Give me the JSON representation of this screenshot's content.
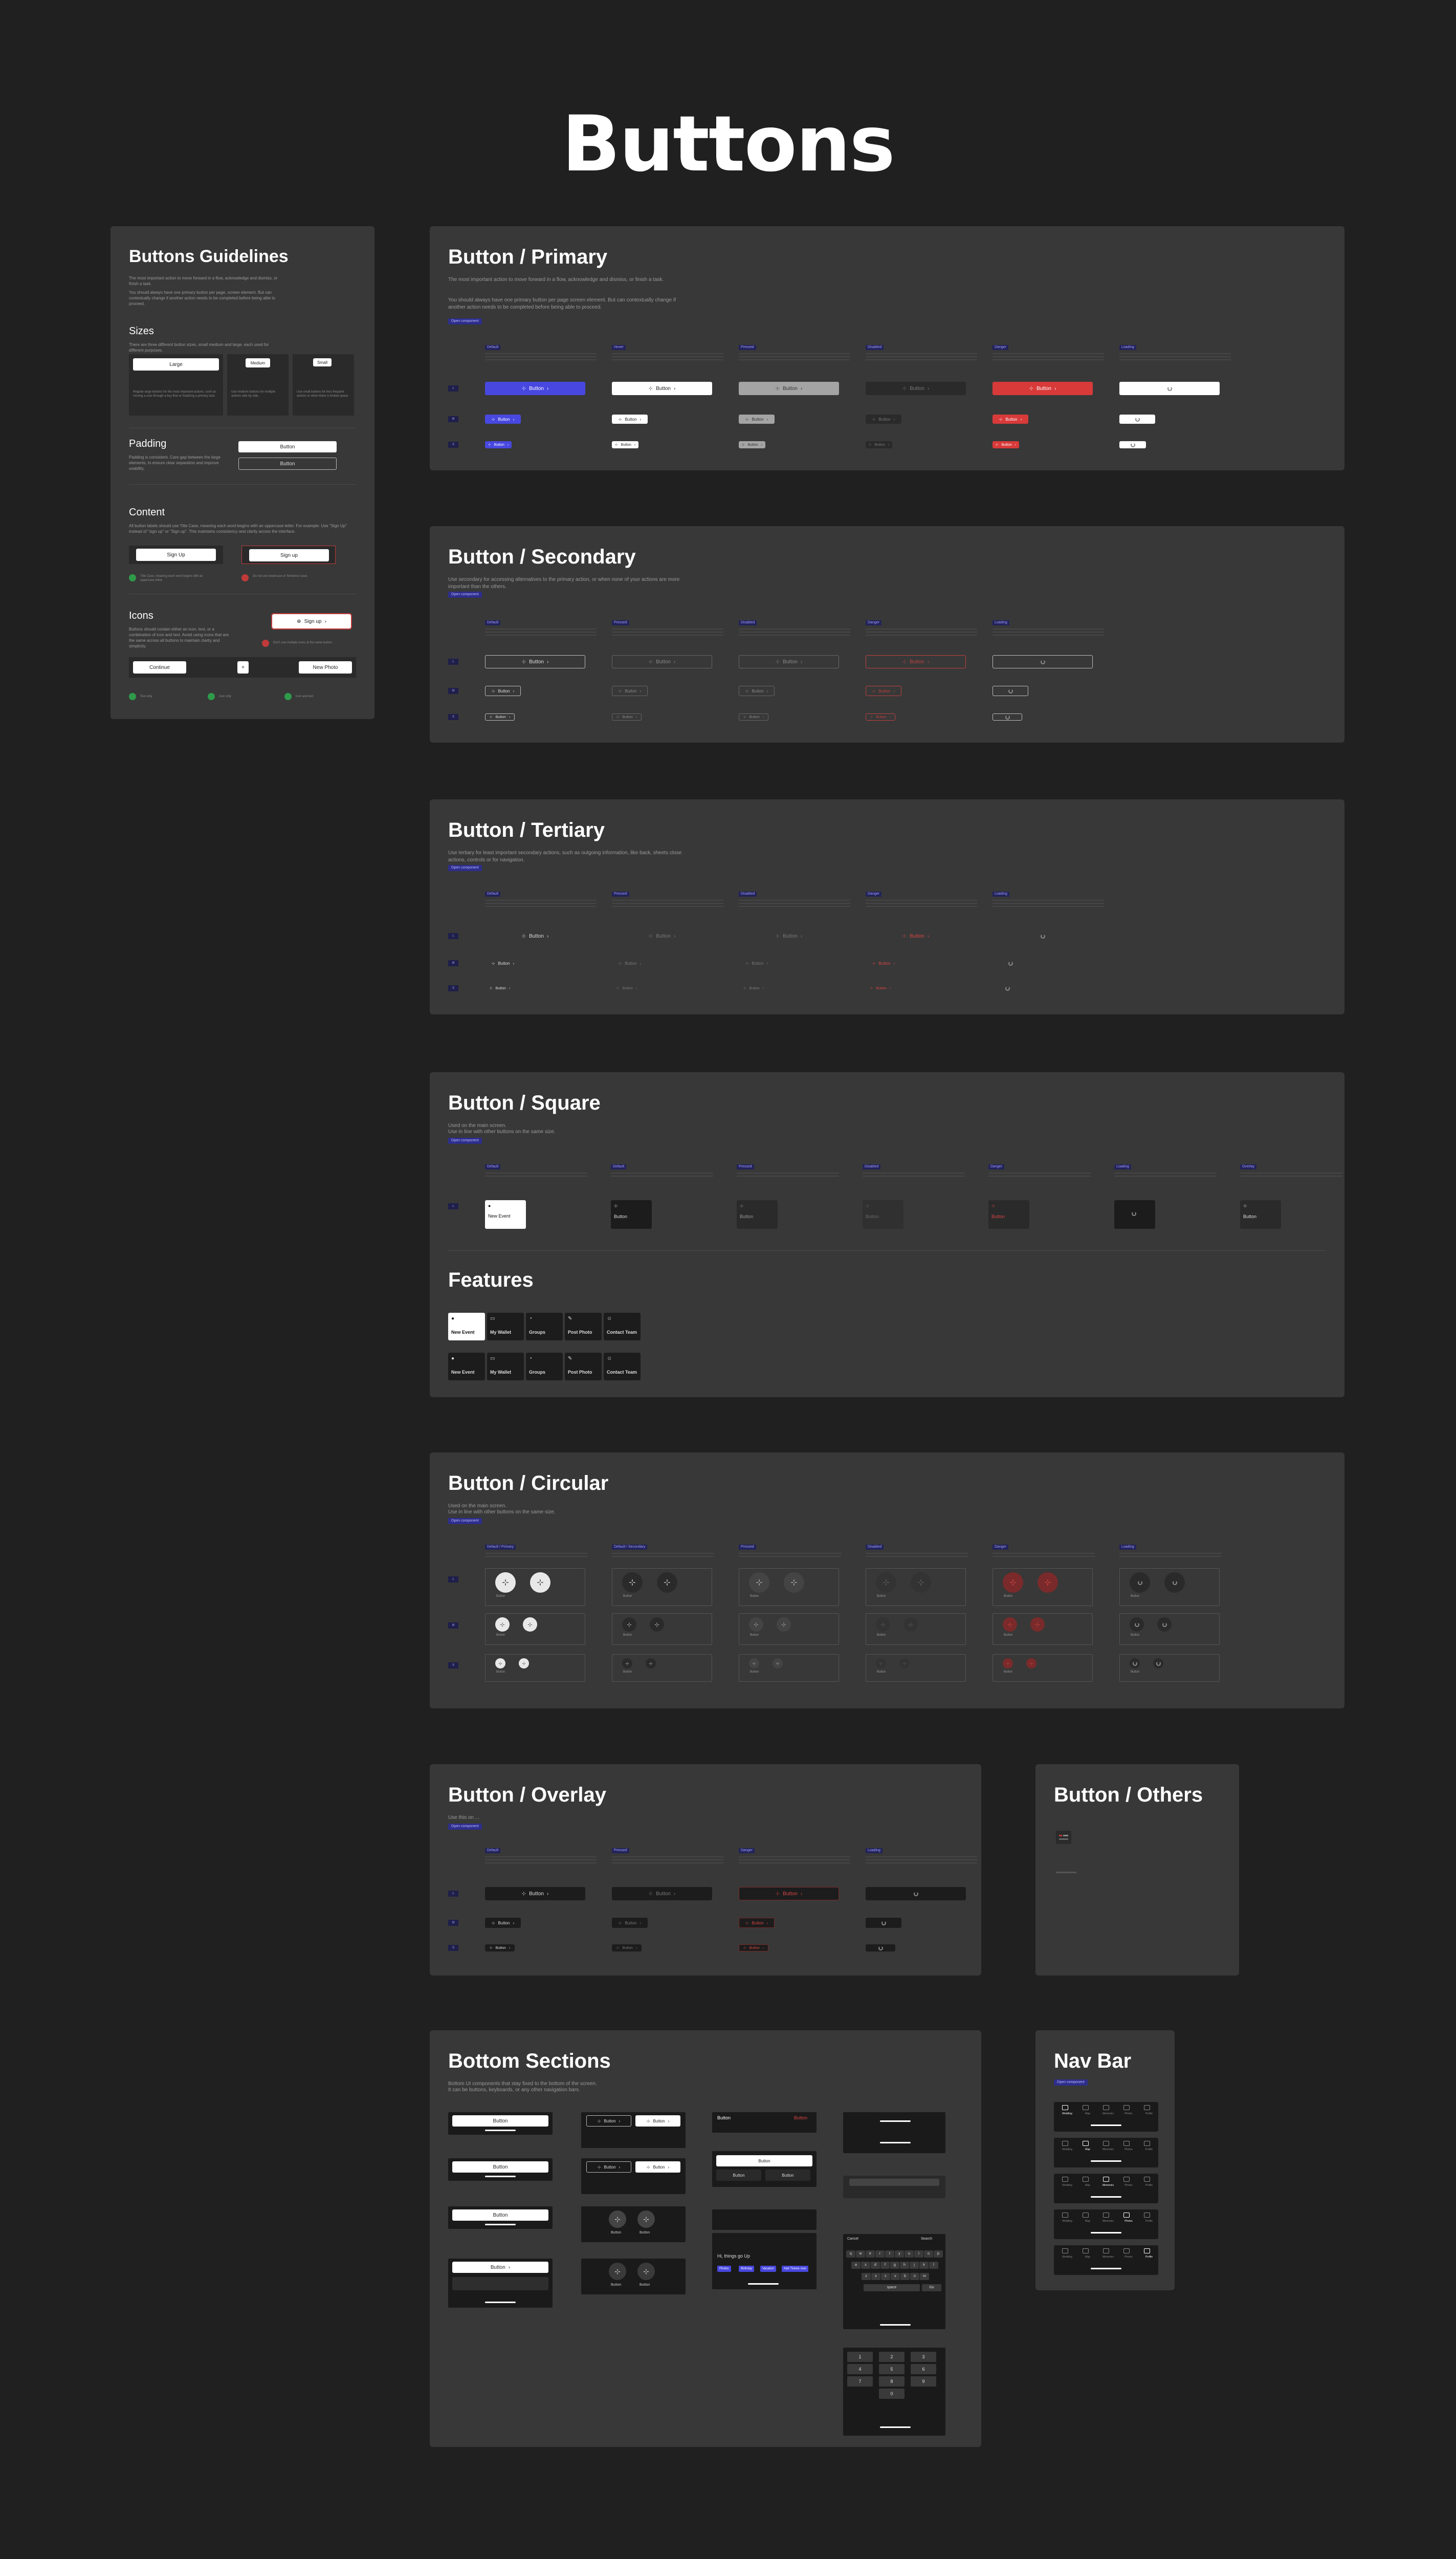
{
  "page_title": "Buttons",
  "guidelines": {
    "title": "Buttons Guidelines",
    "intro": "The most important action to move forward in a flow, acknowledge and dismiss, or finish a task.",
    "intro2": "You should always have one primary button per page, screen element. But can contextually change if another action needs to be completed before being able to proceed.",
    "sizes_h": "Sizes",
    "sizes_p": "There are three different button sizes, small medium and large, each used for different purposes.",
    "size_large": "Large",
    "size_medium": "Medium",
    "size_small": "Small",
    "size_large_p": "Regular large buttons for the most important actions, such as moving a user through a key flow or finalizing a primary task.",
    "size_medium_p": "Use medium buttons for multiple actions side by side.",
    "size_small_p": "Use small buttons for less frequent actions or when there is limited space.",
    "padding_h": "Padding",
    "padding_p": "Padding is consistent. Care gap between the large elements, to ensure clear separation and improve usability.",
    "padding_btn1": "Button",
    "padding_btn2": "Button",
    "content_h": "Content",
    "content_p": "All button labels should use Title Case, meaning each word begins with an uppercase letter. For example: Use \"Sign Up\" instead of \"sign up\" or \"Sign up\". This maintains consistency and clarity across the interface.",
    "signup1": "Sign Up",
    "signup2": "Sign up",
    "do_text": "Title Case, meaning each word begins with an uppercase letter.",
    "dont_text": "Do not use lowercase or Sentence case.",
    "icons_h": "Icons",
    "icons_p": "Buttons should contain either an icon, text, or a combination of icon and text. Avoid using icons that are the same across all buttons to maintain clarity and simplicity.",
    "icons_btn": "Sign up",
    "dont_icons": "Don't use multiple icons at the same button.",
    "continue": "Continue",
    "new_photo": "New Photo",
    "ok1": "Text only",
    "ok2": "Icon only",
    "ok3": "Icon and text"
  },
  "primary": {
    "title": "Button / Primary",
    "desc": "The most important action to move forward in a flow, acknowledge and dismiss, or finish a task.",
    "desc2": "You should always have one primary button per page screen element. But can contextually change if another action needs to be completed before being able to proceed.",
    "link": "Open component",
    "cols": [
      "Default",
      "Hover",
      "Pressed",
      "Disabled",
      "Danger",
      "Loading"
    ],
    "label": "Button"
  },
  "secondary": {
    "title": "Button / Secondary",
    "desc": "Use secondary for accessing alternatives to the primary action, or when none of your actions are more important than the others.",
    "link": "Open component",
    "cols": [
      "Default",
      "Pressed",
      "Disabled",
      "Danger",
      "Loading"
    ],
    "label": "Button"
  },
  "tertiary": {
    "title": "Button / Tertiary",
    "desc": "Use tertiary for least important secondary actions, such as outgoing information, like back, sheets close actions, controls or for navigation.",
    "link": "Open component",
    "cols": [
      "Default",
      "Pressed",
      "Disabled",
      "Danger",
      "Loading"
    ],
    "label": "Button"
  },
  "square": {
    "title": "Button / Square",
    "desc": "Used on the main screen.",
    "desc2": "Use in line with other buttons on the same size.",
    "link": "Open component",
    "cols": [
      "Default",
      "Default",
      "Pressed",
      "Disabled",
      "Danger",
      "Loading",
      "Overlay"
    ],
    "new_event": "New Event",
    "label": "Button"
  },
  "features": {
    "title": "Features",
    "items": [
      "New Event",
      "My Wallet",
      "Groups",
      "Post Photo",
      "Contact Team"
    ]
  },
  "circular": {
    "title": "Button / Circular",
    "desc": "Used on the main screen.",
    "desc2": "Use in line with other buttons on the same size.",
    "link": "Open component",
    "cols": [
      "Default / Primary",
      "Default / Secondary",
      "Pressed",
      "Disabled",
      "Danger",
      "Loading"
    ],
    "label": "Button"
  },
  "overlay": {
    "title": "Button / Overlay",
    "desc": "Use this on ...",
    "link": "Open component",
    "cols": [
      "Default",
      "Pressed",
      "Danger",
      "Loading"
    ],
    "label": "Button"
  },
  "others": {
    "title": "Button / Others"
  },
  "bottom": {
    "title": "Bottom Sections",
    "desc": "Bottom UI components that stay fixed to the bottom of the screen.",
    "desc2": "It can be buttons, keyboards, or any other navigation bars.",
    "button": "Button",
    "cancel": "Cancel",
    "search": "Search",
    "keys_row1": [
      "q",
      "w",
      "e",
      "r",
      "t",
      "y",
      "u",
      "i",
      "o",
      "p"
    ],
    "keys_row2": [
      "a",
      "s",
      "d",
      "f",
      "g",
      "h",
      "j",
      "k",
      "l"
    ],
    "keys_row3": [
      "z",
      "x",
      "c",
      "v",
      "b",
      "n",
      "m"
    ],
    "numpad": [
      "1",
      "2",
      "3",
      "4",
      "5",
      "6",
      "7",
      "8",
      "9",
      "0"
    ],
    "space": "space",
    "go": "Go",
    "hint": "Hi, things go Up",
    "chips": [
      "Photos",
      "Birthday",
      "Vacation",
      "Add Tickets now"
    ]
  },
  "navbar": {
    "title": "Nav Bar",
    "link": "Open component",
    "items": [
      "Wedding",
      "Map",
      "Memories",
      "Photos",
      "Profile"
    ]
  }
}
